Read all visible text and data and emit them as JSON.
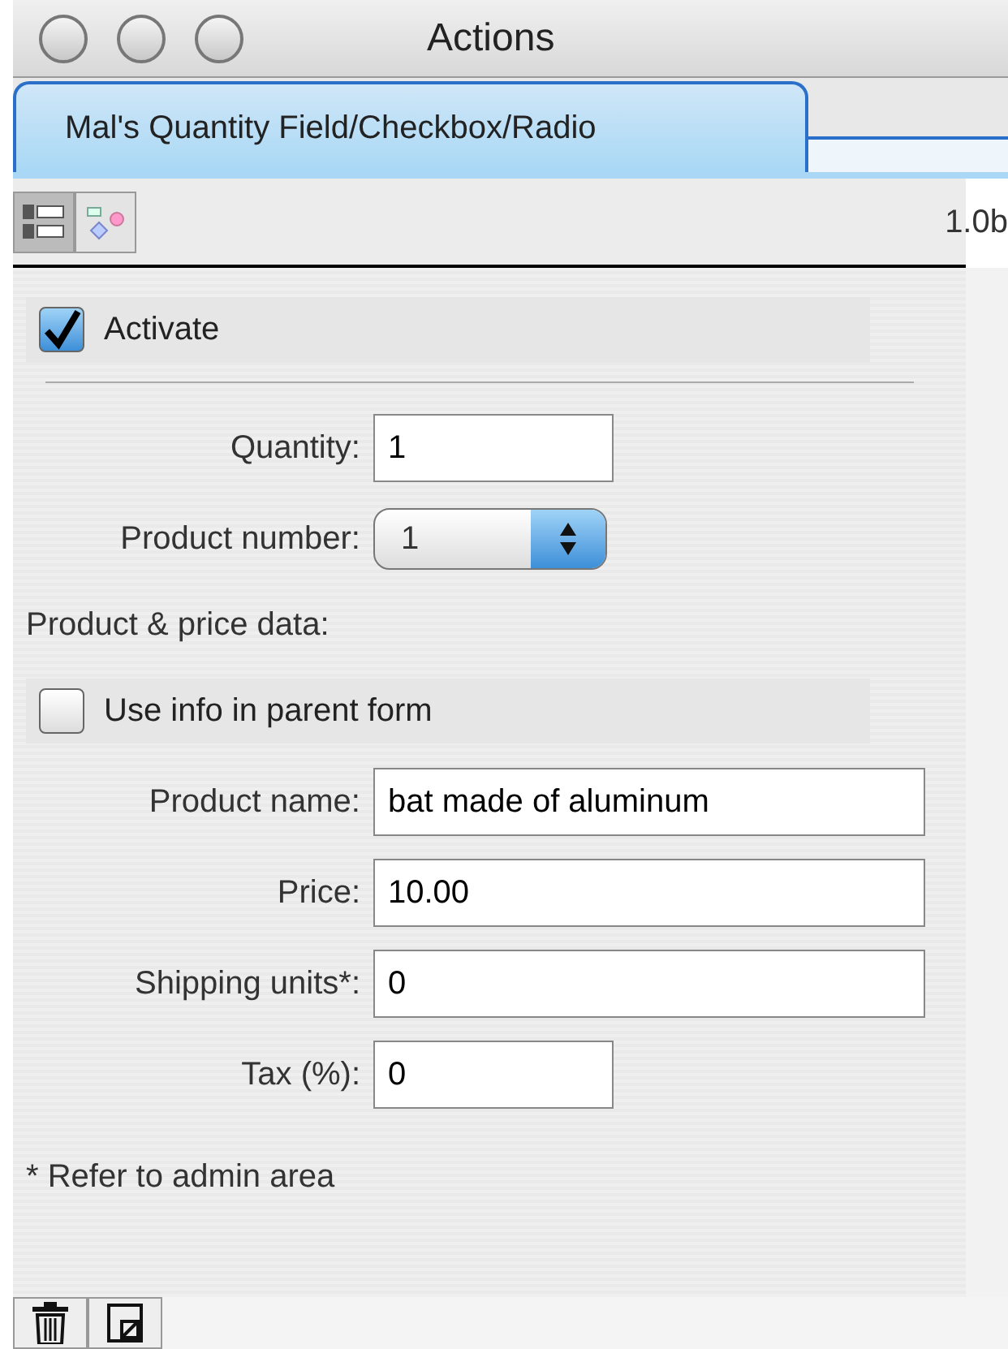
{
  "window": {
    "title": "Actions"
  },
  "tabs": [
    {
      "label": "Mal's Quantity Field/Checkbox/Radio",
      "selected": true
    }
  ],
  "toolbar": {
    "views": [
      {
        "kind": "layout",
        "selected": true
      },
      {
        "kind": "diagram",
        "selected": false
      }
    ],
    "version": "1.0b"
  },
  "items": [
    {
      "kind": "checkbox",
      "label": "Activate",
      "checked": true
    },
    {
      "kind": "divider"
    },
    {
      "kind": "field",
      "label": "Quantity:",
      "value": "1"
    },
    {
      "kind": "popup",
      "label": "Product number:",
      "value": "1"
    },
    {
      "kind": "heading",
      "label": "Product & price data:"
    },
    {
      "kind": "checkbox",
      "label": "Use info in parent form",
      "checked": false
    },
    {
      "kind": "widefield",
      "label": "Product name:",
      "value": "bat made of aluminum"
    },
    {
      "kind": "widefield",
      "label": "Price:",
      "value": "10.00"
    },
    {
      "kind": "widefield",
      "label": "Shipping units*:",
      "value": "0"
    },
    {
      "kind": "field",
      "label": "Tax (%):",
      "value": "0"
    },
    {
      "kind": "note",
      "label": "* Refer to admin area"
    }
  ],
  "bottom_buttons": [
    {
      "kind": "delete"
    },
    {
      "kind": "resize"
    }
  ]
}
